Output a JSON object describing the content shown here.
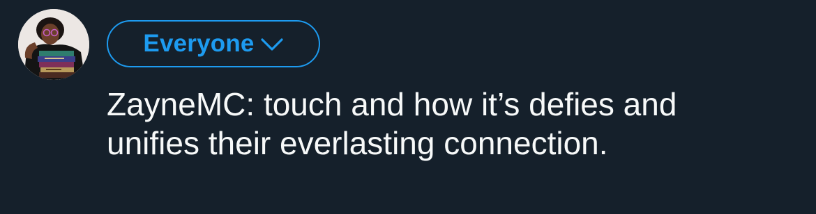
{
  "composer": {
    "avatar_icon": "profile-photo-icon",
    "audience": {
      "label": "Everyone",
      "icon": "chevron-down-icon",
      "accent_color": "#1d9bf0"
    },
    "text": "ZayneMC: touch and how it’s defies and\nunifies their everlasting connection."
  },
  "colors": {
    "background": "#15202b",
    "text": "#f7f9f9",
    "accent": "#1d9bf0"
  }
}
